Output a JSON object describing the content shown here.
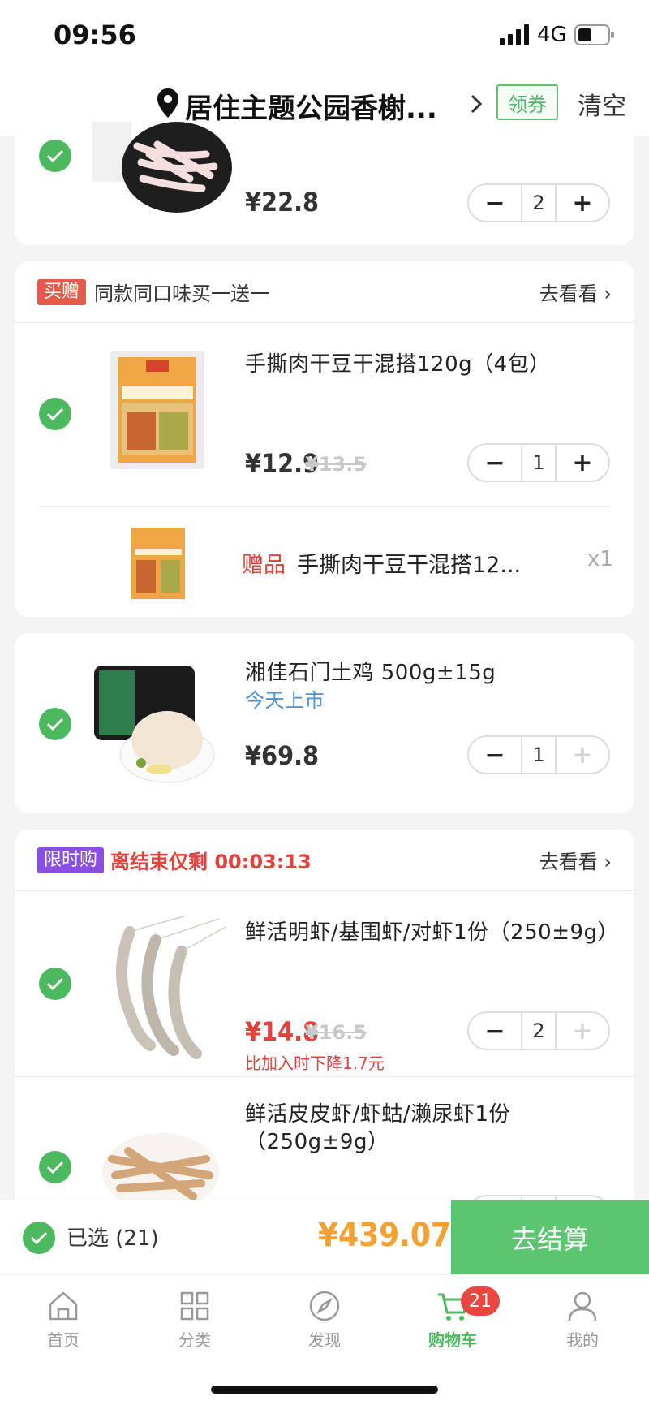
{
  "status": {
    "time": "09:56",
    "network": "4G"
  },
  "header": {
    "address": "居住主题公园香榭...",
    "coupon": "领券",
    "clear": "清空"
  },
  "items": [
    {
      "price": "¥22.8",
      "qty": "2",
      "image": "chicken-feet"
    },
    {
      "promo_tag": "买赠",
      "promo_text": "同款同口味买一送一",
      "look": "去看看",
      "title": "手撕肉干豆干混搭120g（4包）",
      "price": "¥12.9",
      "old_price": "¥13.5",
      "qty": "1",
      "gift_label": "赠品",
      "gift_title": "手撕肉干豆干混搭12...",
      "gift_qty": "x1"
    },
    {
      "title": "湘佳石门土鸡 500g±15g",
      "subtitle": "今天上市",
      "price": "¥69.8",
      "qty": "1"
    },
    {
      "promo_tag": "限时购",
      "promo_text": "离结束仅剩 00:03:13",
      "look": "去看看"
    },
    {
      "title": "鲜活明虾/基围虾/对虾1份（250±9g）",
      "price": "¥14.8",
      "old_price": "¥16.5",
      "qty": "2",
      "note": "比加入时下降1.7元"
    },
    {
      "title": "鲜活皮皮虾/虾蛄/濑尿虾1份（250g±9g）"
    }
  ],
  "checkout": {
    "selected": "已选 (21)",
    "total": "¥439.07",
    "button": "去结算"
  },
  "tabs": [
    {
      "label": "首页",
      "icon": "home-icon"
    },
    {
      "label": "分类",
      "icon": "grid-icon"
    },
    {
      "label": "发现",
      "icon": "compass-icon"
    },
    {
      "label": "购物车",
      "icon": "cart-icon"
    },
    {
      "label": "我的",
      "icon": "person-icon"
    }
  ],
  "cart_badge": "21",
  "colors": {
    "accent": "#4cb95e",
    "price_red": "#e5403a",
    "total_orange": "#f5a030",
    "limited_purple": "#8a4ee3"
  }
}
